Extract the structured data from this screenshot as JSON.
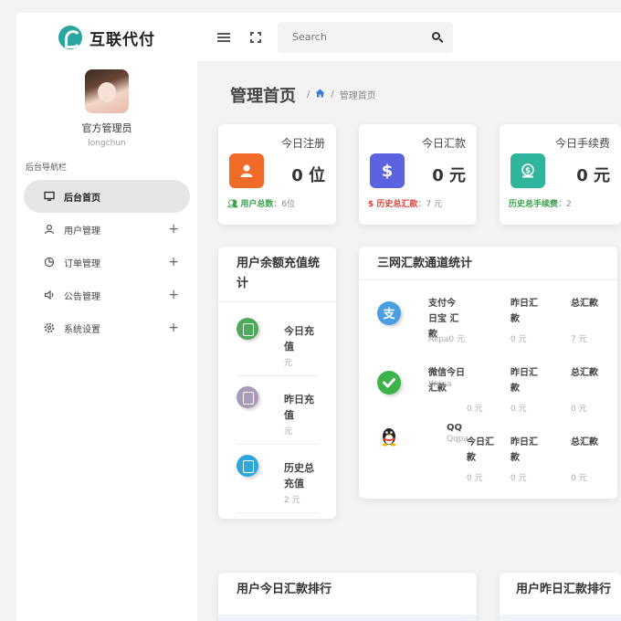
{
  "brand": {
    "title": "互联代付"
  },
  "profile": {
    "name": "官方管理员",
    "username": "longchun"
  },
  "nav": {
    "heading": "后台导航栏",
    "items": [
      {
        "label": "后台首页",
        "icon": "monitor-icon",
        "active": true
      },
      {
        "label": "用户管理",
        "icon": "user-icon",
        "expand": "+"
      },
      {
        "label": "订单管理",
        "icon": "pie-chart-icon",
        "expand": "+"
      },
      {
        "label": "公告管理",
        "icon": "speaker-icon",
        "expand": "+"
      },
      {
        "label": "系统设置",
        "icon": "gear-icon",
        "expand": "+"
      }
    ]
  },
  "search": {
    "placeholder": "Search"
  },
  "page": {
    "title": "管理首页",
    "breadcrumb_sep": "/",
    "breadcrumb_current": "管理首页"
  },
  "stats": [
    {
      "title": "今日注册",
      "value": "0 位",
      "foot_label": "用户总数",
      "foot_value": "：6位",
      "color": "#f06a2a",
      "glyph": "person"
    },
    {
      "title": "今日汇款",
      "value": "0 元",
      "foot_label": "$ 历史总汇款",
      "foot_value": "：7 元",
      "color": "#5b63e0",
      "glyph": "$"
    },
    {
      "title": "今日手续费",
      "value": "0 元",
      "foot_label": "历史总手续费",
      "foot_value": "：2",
      "color": "#2fb59b",
      "glyph": "$"
    }
  ],
  "recharge": {
    "title": "用户余额充值统计",
    "items": [
      {
        "label": "今日充值",
        "unit": "元",
        "color": "#4caa5a"
      },
      {
        "label": "昨日充值",
        "unit": "元",
        "color": "#a89bb8"
      },
      {
        "label": "历史总充值",
        "unit": "2 元",
        "color": "#2ea8d8"
      }
    ]
  },
  "channels": {
    "title": "三网汇款通道统计",
    "rows": [
      {
        "name": "支付今日宝",
        "today": "汇款",
        "sub": "Alipa",
        "today_val": "0 元",
        "yesterday": "昨日汇款",
        "yesterday_val": "0 元",
        "total": "总汇款",
        "total_val": "7 元",
        "color": "#4a9fe3"
      },
      {
        "name": "微信今日",
        "today": "汇款",
        "sub": "Wxpa",
        "today_val": "0 元",
        "yesterday": "昨日汇款",
        "yesterday_val": "0 元",
        "total": "总汇款",
        "total_val": "0 元",
        "color": "#3cb44a"
      },
      {
        "name": "QQ",
        "today": "今日汇款",
        "sub": "Qqpa",
        "today_val": "0 元",
        "yesterday": "昨日汇款",
        "yesterday_val": "0 元",
        "total": "总汇款",
        "total_val": "0 元",
        "color": "#222222"
      }
    ]
  },
  "rankings": [
    {
      "title": "用户今日汇款排行"
    },
    {
      "title": "用户昨日汇款排行"
    }
  ]
}
